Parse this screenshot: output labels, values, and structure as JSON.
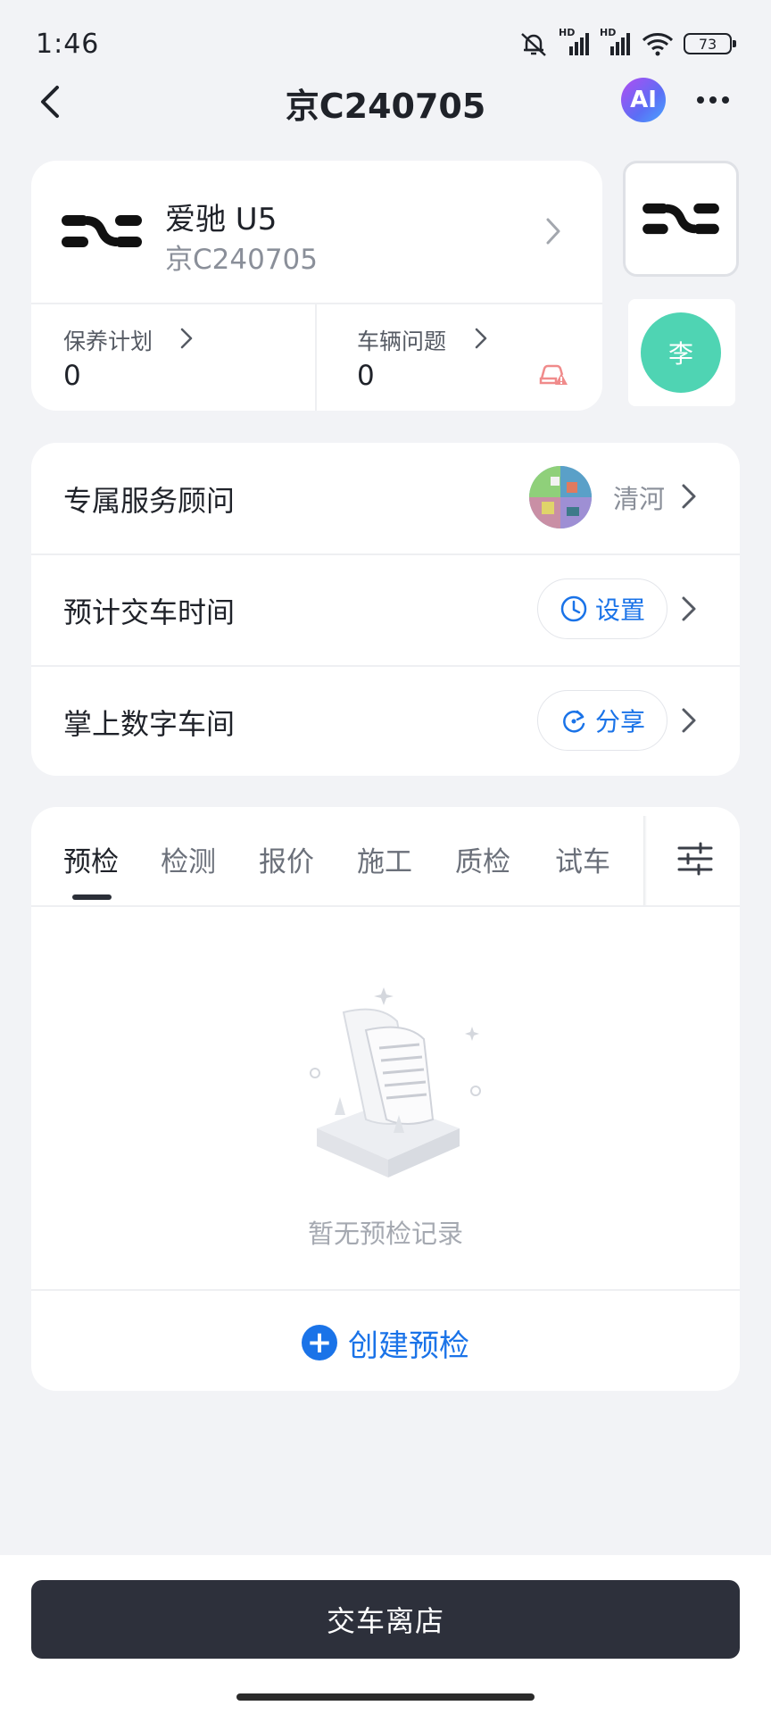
{
  "status_bar": {
    "time": "1:46",
    "network_1": "HD",
    "network_2": "HD",
    "battery": "73"
  },
  "nav": {
    "title": "京C240705",
    "ai_label": "AI"
  },
  "vehicle": {
    "name": "爱驰 U5",
    "plate": "京C240705",
    "maintenance_label": "保养计划",
    "maintenance_count": "0",
    "issues_label": "车辆问题",
    "issues_count": "0"
  },
  "side_panel": {
    "avatar_text": "李"
  },
  "service": {
    "consultant_label": "专属服务顾问",
    "consultant_name": "清河",
    "delivery_label": "预计交车时间",
    "delivery_action": "设置",
    "workshop_label": "掌上数字车间",
    "workshop_action": "分享"
  },
  "tabs": [
    {
      "label": "预检"
    },
    {
      "label": "检测"
    },
    {
      "label": "报价"
    },
    {
      "label": "施工"
    },
    {
      "label": "质检"
    },
    {
      "label": "试车"
    }
  ],
  "empty_state": {
    "text": "暂无预检记录"
  },
  "create": {
    "label": "创建预检"
  },
  "bottom": {
    "primary_label": "交车离店"
  },
  "colors": {
    "accent": "#1a73e8",
    "avatar": "#4fd4b3",
    "primary_button": "#2d303b",
    "background": "#f2f3f6"
  }
}
